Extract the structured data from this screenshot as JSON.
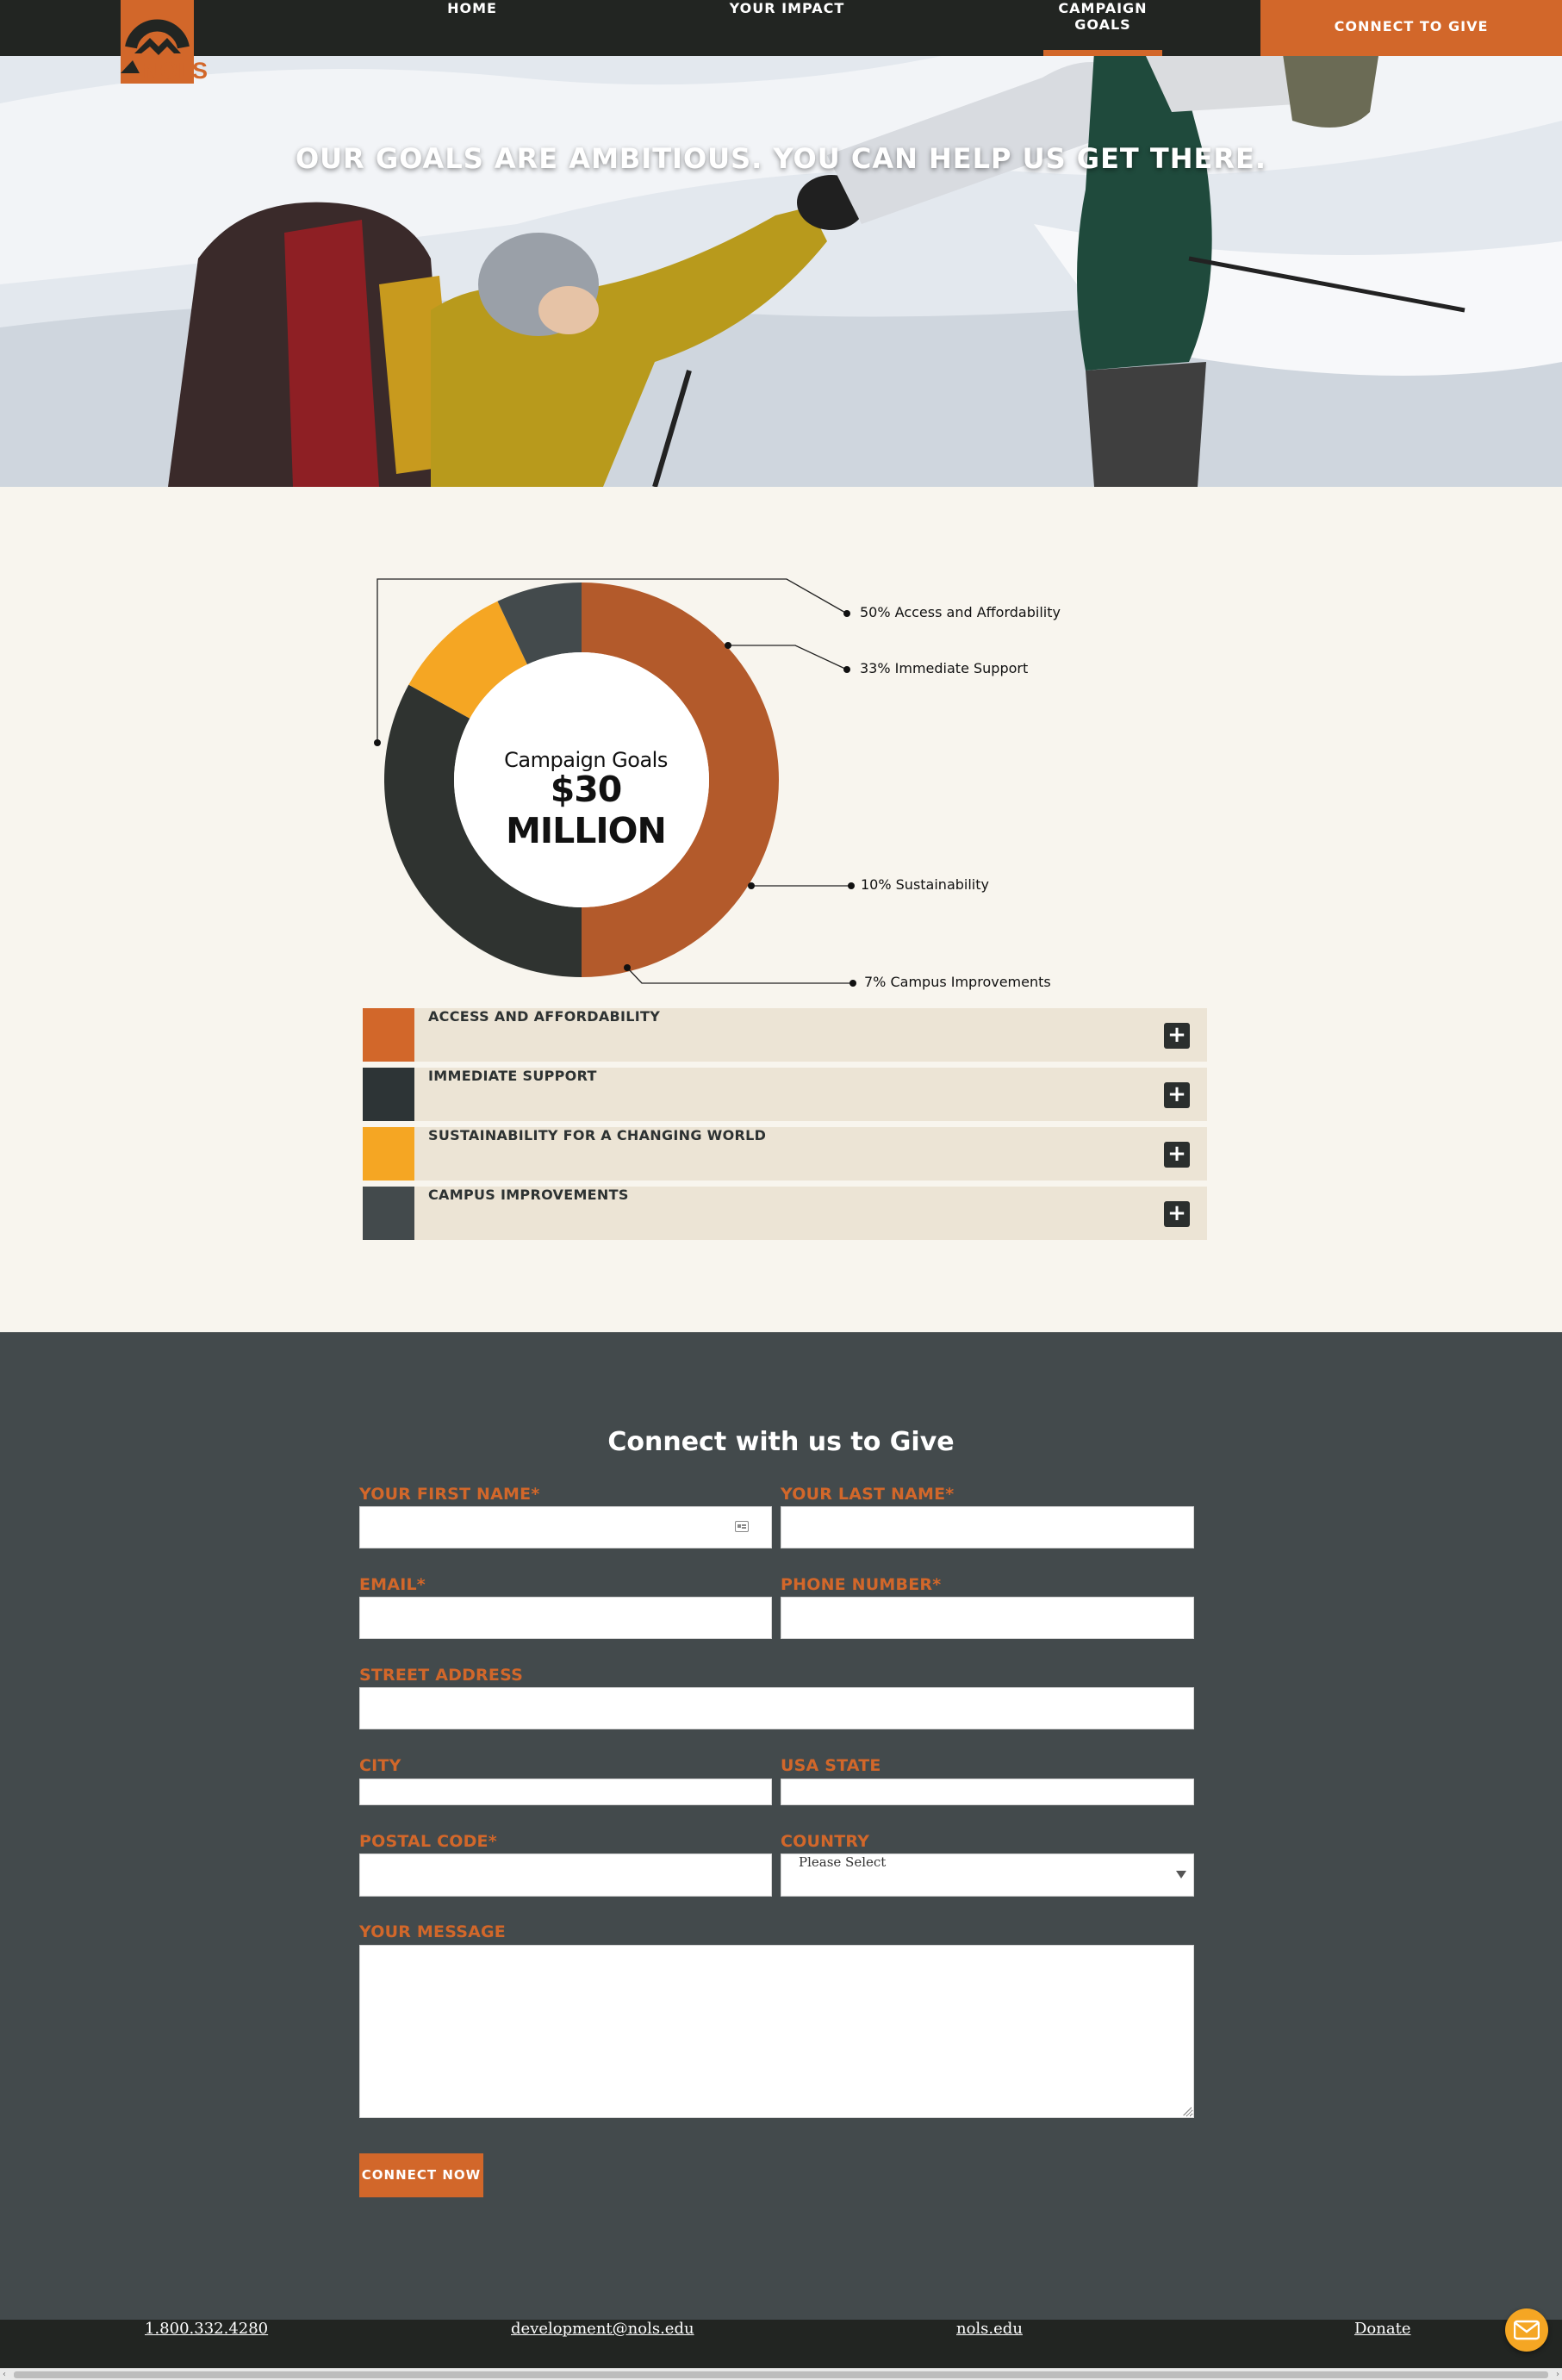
{
  "brand": {
    "logo_text": "NOLS",
    "accent": "#d2672a"
  },
  "nav": {
    "items": [
      {
        "label": "HOME"
      },
      {
        "label": "YOUR IMPACT"
      },
      {
        "label": "CAMPAIGN GOALS"
      }
    ],
    "cta_label": "CONNECT TO GIVE"
  },
  "hero": {
    "title": "OUR GOALS ARE AMBITIOUS. YOU CAN HELP US GET THERE."
  },
  "campaign": {
    "center_subtitle": "Campaign Goals",
    "center_title": "$30 MILLION",
    "callouts": [
      "50% Access and Affordability",
      "33% Immediate Support",
      "10% Sustainability",
      "7% Campus Improvements"
    ],
    "accordion": [
      {
        "label": "ACCESS AND AFFORDABILITY",
        "color": "#d2672a"
      },
      {
        "label": "IMMEDIATE SUPPORT",
        "color": "#2d3436"
      },
      {
        "label": "SUSTAINABILITY FOR A CHANGING WORLD",
        "color": "#f5a623"
      },
      {
        "label": "CAMPUS IMPROVEMENTS",
        "color": "#434a4c"
      }
    ],
    "expand_symbol": "+"
  },
  "chart_data": {
    "type": "pie",
    "title": "Campaign Goals",
    "subtitle": "$30 MILLION",
    "categories": [
      "Access and Affordability",
      "Immediate Support",
      "Sustainability",
      "Campus Improvements"
    ],
    "values": [
      50,
      33,
      10,
      7
    ],
    "colors": [
      "#b35a2b",
      "#2f3330",
      "#f5a623",
      "#434a4c"
    ]
  },
  "form": {
    "title": "Connect with us to Give",
    "labels": {
      "first_name": "YOUR FIRST NAME*",
      "last_name": "YOUR LAST NAME*",
      "email": "EMAIL*",
      "phone": "PHONE NUMBER*",
      "street": "STREET ADDRESS",
      "city": "CITY",
      "state": "USA STATE",
      "postal": "POSTAL CODE*",
      "country": "COUNTRY",
      "message": "YOUR MESSAGE"
    },
    "country_selected": "Please Select",
    "submit_label": "CONNECT NOW"
  },
  "footer": {
    "phone": "1.800.332.4280",
    "email": "development@nols.edu",
    "site": "nols.edu",
    "donate": "Donate"
  }
}
